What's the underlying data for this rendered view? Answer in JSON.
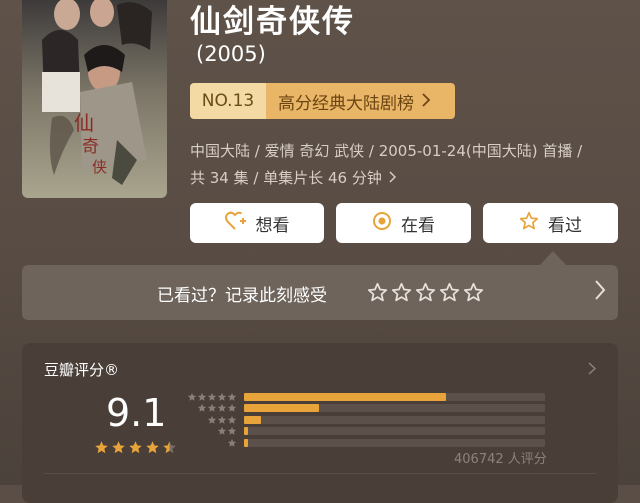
{
  "poster": {
    "alt": "仙剑奇侠传 poster"
  },
  "title": "仙剑奇侠传",
  "year": "(2005)",
  "rank": {
    "number": "NO.13",
    "label": "高分经典大陆剧榜"
  },
  "meta": {
    "line1": "中国大陆 / 爱情 奇幻 武侠 / 2005-01-24(中国大陆) 首播 /",
    "line2": "共 34 集 / 单集片长 46 分钟"
  },
  "actions": [
    {
      "label": "想看",
      "icon": "heart-plus-icon"
    },
    {
      "label": "在看",
      "icon": "target-icon"
    },
    {
      "label": "看过",
      "icon": "star-outline-icon"
    }
  ],
  "rate_prompt": {
    "text": "已看过？记录此刻感受",
    "stars": 5
  },
  "score": {
    "label": "豆瓣评分®",
    "value": "9.1",
    "stars": 4.5,
    "count_text": "406742 人评分",
    "distribution": [
      {
        "stars": 5,
        "fraction": 0.67
      },
      {
        "stars": 4,
        "fraction": 0.25
      },
      {
        "stars": 3,
        "fraction": 0.055
      },
      {
        "stars": 2,
        "fraction": 0.013
      },
      {
        "stars": 1,
        "fraction": 0.012
      }
    ]
  },
  "colors": {
    "accent": "#e8a43a",
    "rank_bg": "#e9b567",
    "rank_no_bg": "#f3d9a4",
    "background": "#5a4e46"
  }
}
